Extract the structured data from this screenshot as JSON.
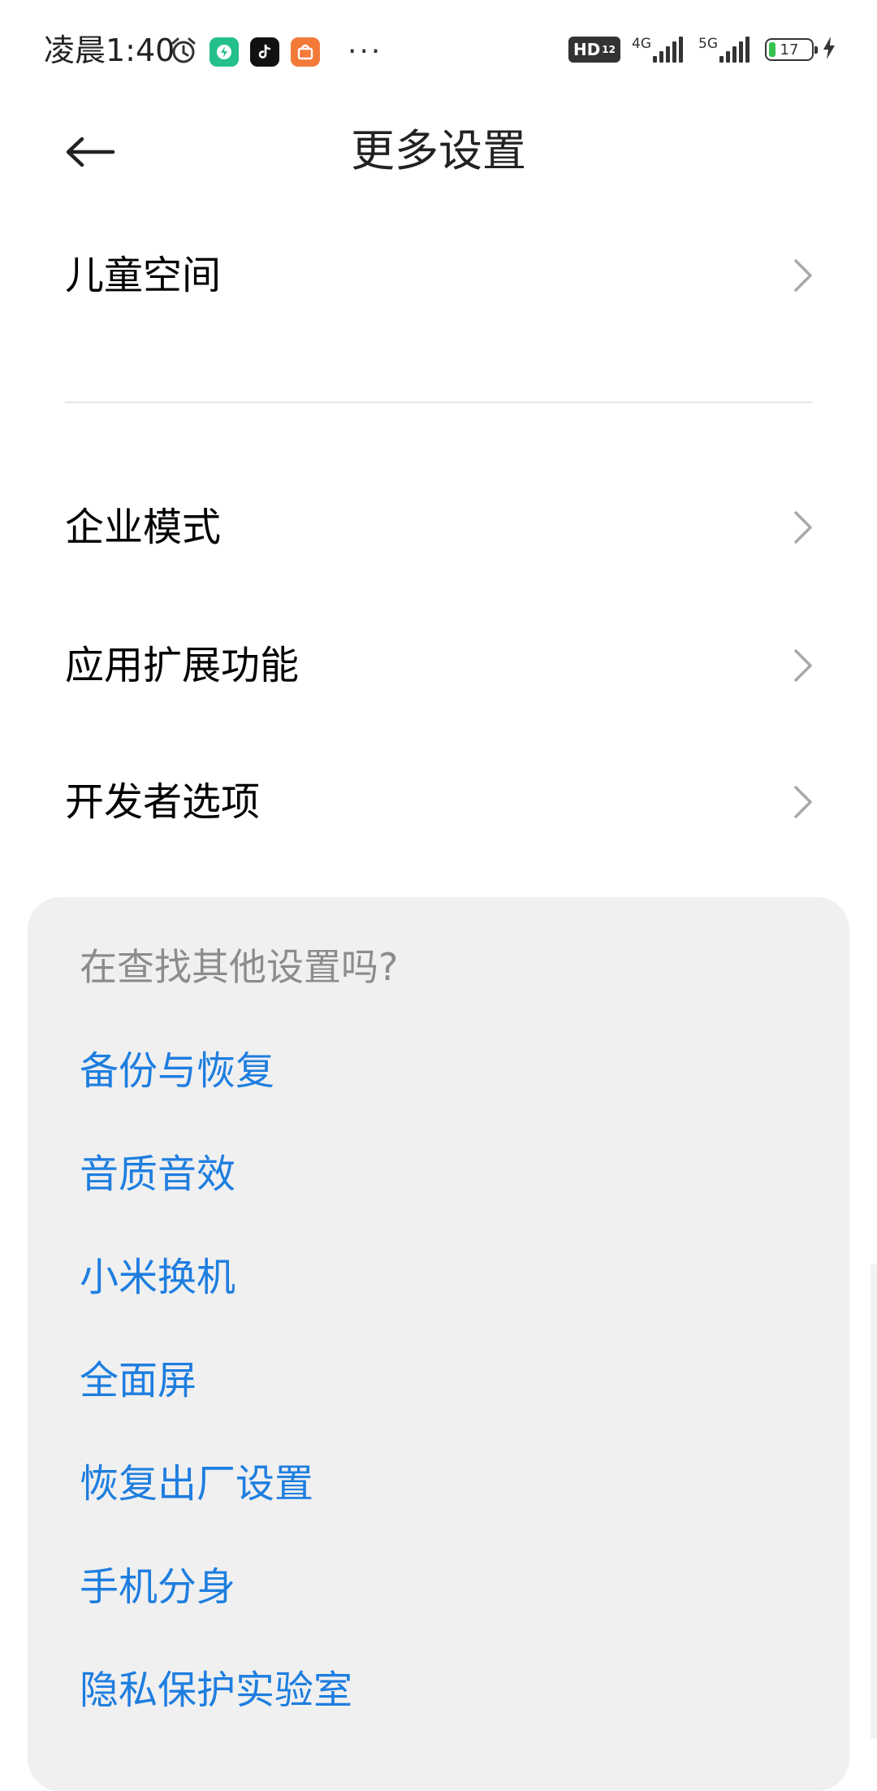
{
  "status_bar": {
    "time": "凌晨1:40",
    "more": "···",
    "hd": "HD",
    "hd_sub": "12",
    "signal1_label": "4G",
    "signal2_label": "5G",
    "battery_level": "17"
  },
  "header": {
    "title": "更多设置"
  },
  "items": [
    {
      "label": "儿童空间"
    },
    {
      "label": "企业模式"
    },
    {
      "label": "应用扩展功能"
    },
    {
      "label": "开发者选项"
    }
  ],
  "suggestions": {
    "title": "在查找其他设置吗?",
    "links": [
      {
        "label": "备份与恢复"
      },
      {
        "label": "音质音效"
      },
      {
        "label": "小米换机"
      },
      {
        "label": "全面屏"
      },
      {
        "label": "恢复出厂设置"
      },
      {
        "label": "手机分身"
      },
      {
        "label": "隐私保护实验室"
      }
    ]
  },
  "colors": {
    "link": "#1e7ee0",
    "card_bg": "#f0f0f0",
    "muted_text": "#8c8c8c"
  }
}
